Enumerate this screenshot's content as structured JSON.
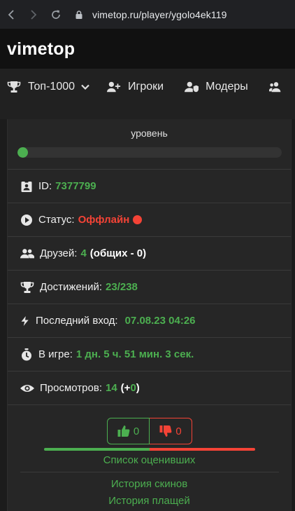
{
  "browser": {
    "url": "vimetop.ru/player/ygolo4ek119"
  },
  "site": {
    "logo": "vimetop"
  },
  "nav": {
    "top_label": "Топ-1000",
    "players_label": "Игроки",
    "mods_label": "Модеры"
  },
  "profile": {
    "level_label": "уровень",
    "level_progress": 0,
    "id_label": "ID:",
    "id_value": "7377799",
    "status_label": "Статус:",
    "status_value": "Оффлайн",
    "friends_label": "Друзей:",
    "friends_value": "4",
    "friends_common": "(общих - 0)",
    "achievements_label": "Достижений:",
    "achievements_value": "23/238",
    "last_login_label": "Последний вход:",
    "last_login_value": "07.08.23 04:26",
    "ingame_label": "В игре:",
    "ingame_value": "1 дн. 5 ч. 51 мин. 3 сек.",
    "views_label": "Просмотров:",
    "views_value": "14",
    "views_delta_open": "(+",
    "views_delta_value": "0",
    "views_delta_close": ")"
  },
  "rating": {
    "likes": "0",
    "dislikes": "0",
    "like_share": 0.5,
    "voters_link": "Список оценивших"
  },
  "links": {
    "skins_history": "История скинов",
    "capes_history": "История плащей"
  },
  "colors": {
    "accent_green": "#4caf50",
    "accent_red": "#f44336",
    "card_bg": "#262626"
  },
  "icons": [
    "back-icon",
    "forward-icon",
    "reload-icon",
    "lock-icon",
    "trophy-icon",
    "chevron-down-icon",
    "user-plus-icon",
    "user-shield-icon",
    "users-icon",
    "id-card-icon",
    "play-circle-icon",
    "bolt-icon",
    "stopwatch-icon",
    "eye-icon",
    "thumbs-up-icon",
    "thumbs-down-icon"
  ]
}
